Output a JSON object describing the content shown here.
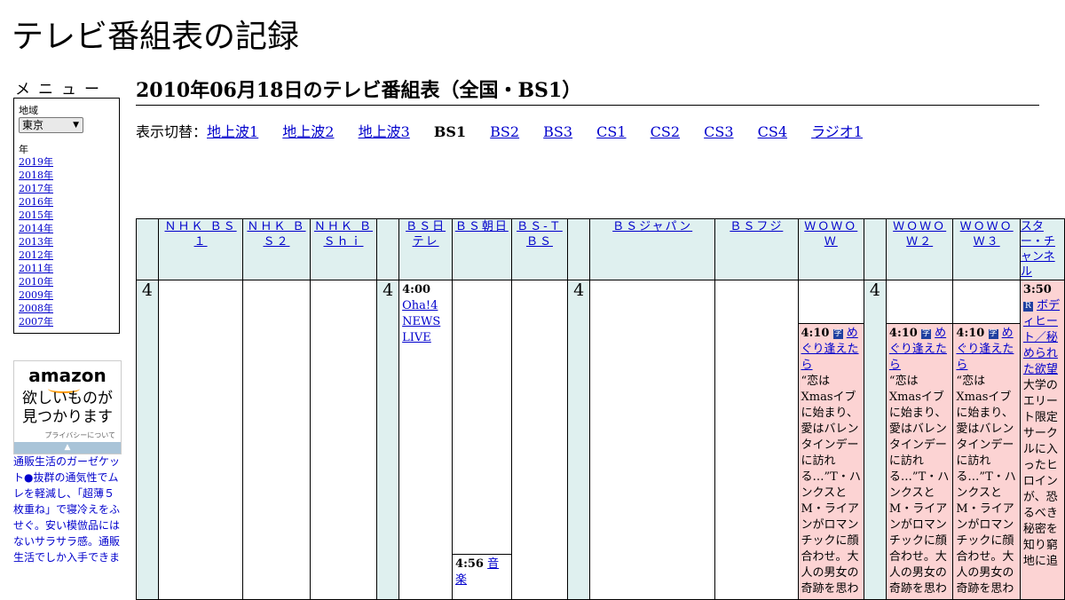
{
  "site_title": "テレビ番組表の記録",
  "menu": {
    "title": "メニュー",
    "region_label": "地域",
    "region_value": "東京",
    "year_label": "年",
    "years": [
      "2019年",
      "2018年",
      "2017年",
      "2016年",
      "2015年",
      "2014年",
      "2013年",
      "2012年",
      "2011年",
      "2010年",
      "2009年",
      "2008年",
      "2007年"
    ]
  },
  "ad": {
    "logo": "amazon",
    "copy_line1": "欲しいものが",
    "copy_line2": "見つかります",
    "privacy": "プライバシーについて",
    "text": "通販生活のガーゼケット●抜群の通気性でムレを軽減し、「超薄５枚重ね」で寝冷えをふせぐ。安い模倣品にはないサラサラ感。通販生活でしか入手できま"
  },
  "heading": "2010年06月18日のテレビ番組表（全国・BS1）",
  "switcher": {
    "lead": "表示切替：",
    "links": [
      "地上波1",
      "地上波2",
      "地上波3",
      "BS1",
      "BS2",
      "BS3",
      "CS1",
      "CS2",
      "CS3",
      "CS4",
      "ラジオ1"
    ],
    "current": "BS1"
  },
  "channels": [
    "ＮＨＫ ＢＳ１",
    "ＮＨＫ ＢＳ２",
    "ＮＨＫ ＢＳｈｉ",
    "ＢＳ日テレ",
    "ＢＳ朝日",
    "ＢＳ-ＴＢＳ",
    "ＢＳジャパン",
    "ＢＳフジ",
    "ＷＯＷＯＷ",
    "ＷＯＷＯＷ２",
    "ＷＯＷＯＷ３",
    "スター・チャンネル"
  ],
  "hour": "4",
  "programs": {
    "bs_nittele": {
      "time": "4:00",
      "title": "Oha!4 NEWS LIVE"
    },
    "bs_asahi": {
      "time": "4:56",
      "title": "音楽"
    },
    "wowow": {
      "time": "4:10",
      "badge": "字",
      "title": "めぐり逢えたら",
      "desc": "“恋はXmasイブに始まり、愛はバレンタインデーに訪れる…”T・ハンクスとM・ライアンがロマンチックに顔合わせ。大人の男女の奇跡を思わ"
    },
    "wowow2": {
      "time": "4:10",
      "badge": "字",
      "title": "めぐり逢えたら",
      "desc": "“恋はXmasイブに始まり、愛はバレンタインデーに訪れる…”T・ハンクスとM・ライアンがロマンチックに顔合わせ。大人の男女の奇跡を思わ"
    },
    "wowow3": {
      "time": "4:10",
      "badge": "字",
      "title": "めぐり逢えたら",
      "desc": "“恋はXmasイブに始まり、愛はバレンタインデーに訪れる…”T・ハンクスとM・ライアンがロマンチックに顔合わせ。大人の男女の奇跡を思わ"
    },
    "star": {
      "time": "3:50",
      "badge": "R",
      "title": "ボディヒート／秘められた欲望",
      "desc": "大学のエリート限定サークルに入ったヒロインが、恐るべき秘密を知り窮地に追"
    }
  }
}
